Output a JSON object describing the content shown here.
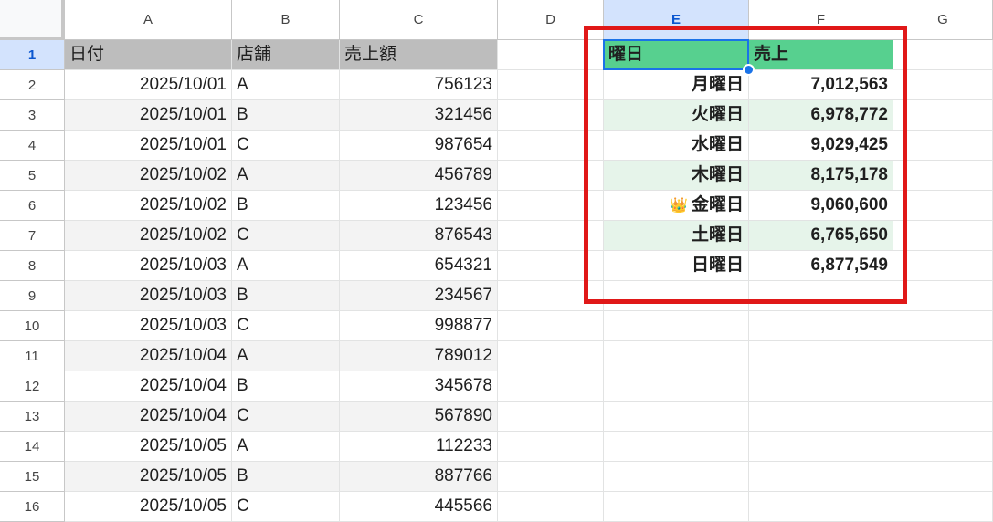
{
  "columns": [
    "A",
    "B",
    "C",
    "D",
    "E",
    "F",
    "G"
  ],
  "rows": [
    "1",
    "2",
    "3",
    "4",
    "5",
    "6",
    "7",
    "8",
    "9",
    "10",
    "11",
    "12",
    "13",
    "14",
    "15",
    "16"
  ],
  "headers": {
    "date": "日付",
    "store": "店舗",
    "sales": "売上額"
  },
  "data": [
    {
      "date": "2025/10/01",
      "store": "A",
      "sales": "756123"
    },
    {
      "date": "2025/10/01",
      "store": "B",
      "sales": "321456"
    },
    {
      "date": "2025/10/01",
      "store": "C",
      "sales": "987654"
    },
    {
      "date": "2025/10/02",
      "store": "A",
      "sales": "456789"
    },
    {
      "date": "2025/10/02",
      "store": "B",
      "sales": "123456"
    },
    {
      "date": "2025/10/02",
      "store": "C",
      "sales": "876543"
    },
    {
      "date": "2025/10/03",
      "store": "A",
      "sales": "654321"
    },
    {
      "date": "2025/10/03",
      "store": "B",
      "sales": "234567"
    },
    {
      "date": "2025/10/03",
      "store": "C",
      "sales": "998877"
    },
    {
      "date": "2025/10/04",
      "store": "A",
      "sales": "789012"
    },
    {
      "date": "2025/10/04",
      "store": "B",
      "sales": "345678"
    },
    {
      "date": "2025/10/04",
      "store": "C",
      "sales": "567890"
    },
    {
      "date": "2025/10/05",
      "store": "A",
      "sales": "112233"
    },
    {
      "date": "2025/10/05",
      "store": "B",
      "sales": "887766"
    },
    {
      "date": "2025/10/05",
      "store": "C",
      "sales": "445566"
    }
  ],
  "summary": {
    "header_day": "曜日",
    "header_sales": "売上",
    "rows": [
      {
        "day": "月曜日",
        "sales": "7,012,563"
      },
      {
        "day": "火曜日",
        "sales": "6,978,772"
      },
      {
        "day": "水曜日",
        "sales": "9,029,425"
      },
      {
        "day": "木曜日",
        "sales": "8,175,178"
      },
      {
        "day": "金曜日",
        "sales": "9,060,600",
        "crown": "👑"
      },
      {
        "day": "土曜日",
        "sales": "6,765,650"
      },
      {
        "day": "日曜日",
        "sales": "6,877,549"
      }
    ]
  },
  "colors": {
    "selection": "#1a73e8",
    "highlight_box": "#e01818",
    "summary_header": "#57d08f",
    "summary_stripe": "#e6f4ea",
    "data_header": "#bdbdbd"
  }
}
